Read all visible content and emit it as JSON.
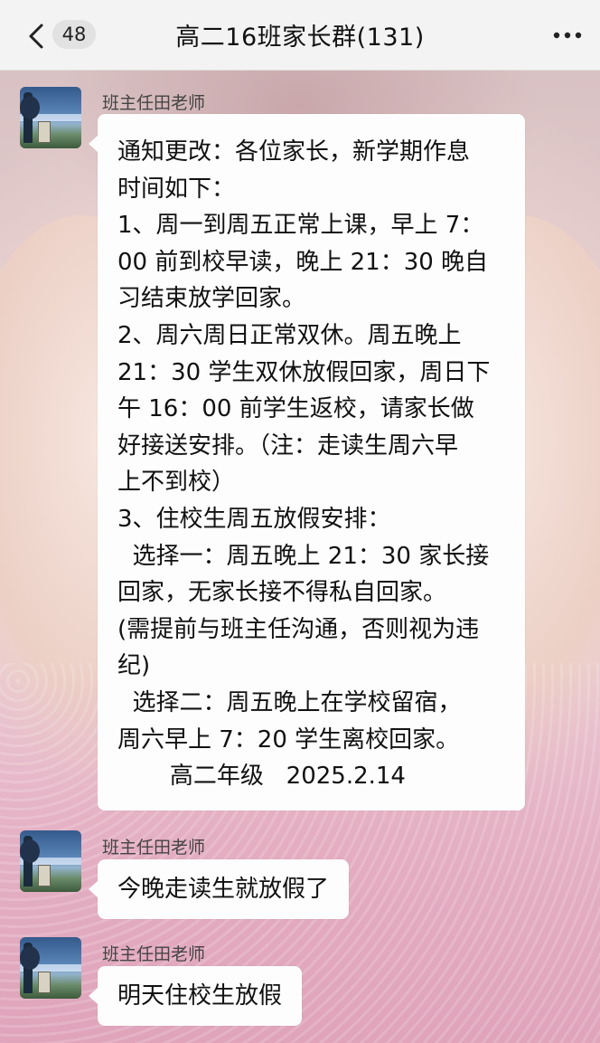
{
  "header": {
    "back_icon": "chevron-left-icon",
    "unread_count": "48",
    "title": "高二16班家长群(131)",
    "more_icon": "more-dots-icon"
  },
  "messages": [
    {
      "sender": "班主任田老师",
      "lines": [
        "通知更改：各位家长，新学期作息",
        "时间如下：",
        "1、周一到周五正常上课，早上 7：",
        "00 前到校早读，晚上 21：30 晚自",
        "习结束放学回家。",
        "2、周六周日正常双休。周五晚上",
        "21：30 学生双休放假回家，周日下",
        "午 16：00 前学生返校，请家长做",
        "好接送安排。（注：走读生周六早",
        "上不到校）",
        "3、住校生周五放假安排：",
        "  选择一：周五晚上 21：30 家长接",
        "回家，无家长接不得私自回家。",
        "(需提前与班主任沟通，否则视为违",
        "纪)",
        "  选择二：周五晚上在学校留宿，",
        "周六早上 7：20 学生离校回家。",
        "       高二年级   2025.2.14"
      ]
    },
    {
      "sender": "班主任田老师",
      "text": "今晚走读生就放假了"
    },
    {
      "sender": "班主任田老师",
      "text": "明天住校生放假"
    }
  ]
}
